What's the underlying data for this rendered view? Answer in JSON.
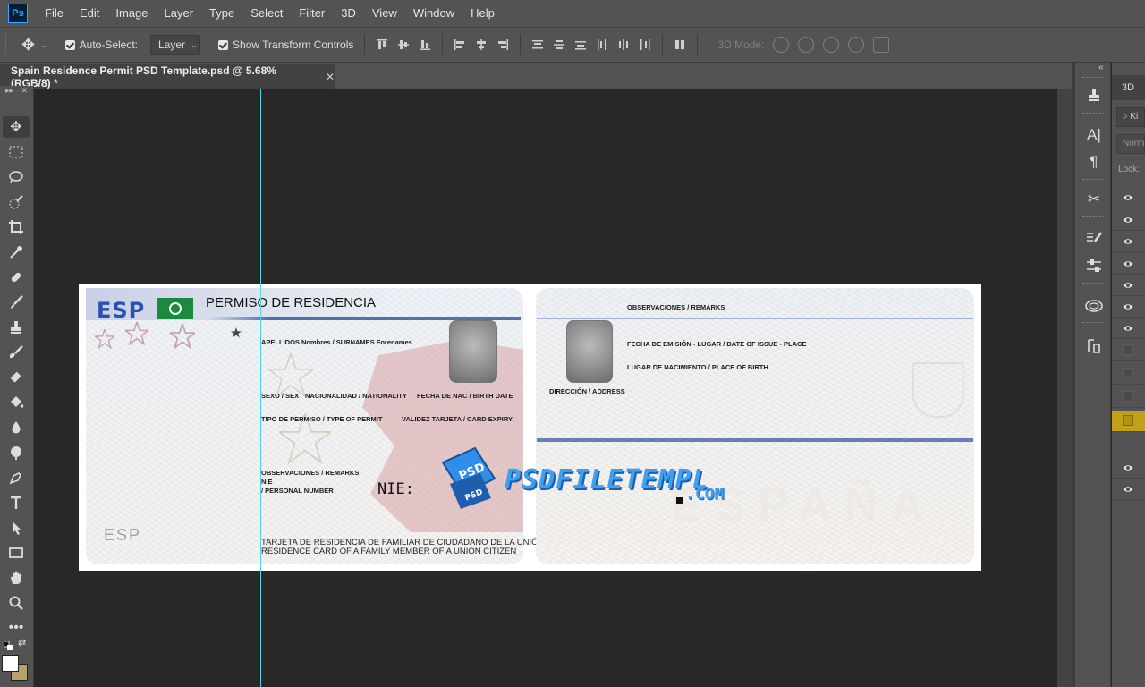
{
  "app": {
    "logo": "Ps"
  },
  "menu": [
    "File",
    "Edit",
    "Image",
    "Layer",
    "Type",
    "Select",
    "Filter",
    "3D",
    "View",
    "Window",
    "Help"
  ],
  "options": {
    "tool_icon": "move-icon",
    "auto_select_label": "Auto-Select:",
    "auto_select_checked": true,
    "target_value": "Layer",
    "transform_label": "Show Transform Controls",
    "transform_checked": true,
    "mode_3d_label": "3D Mode:"
  },
  "document": {
    "tab_title": "Spain Residence Permit PSD Template.psd @ 5.68% (RGB/8) *",
    "close_glyph": "✕"
  },
  "toolbox": {
    "head_left": "▸▸",
    "head_right": "✕",
    "tools": [
      "move-icon",
      "marquee-icon",
      "lasso-icon",
      "quick-select-icon",
      "crop-icon",
      "eyedropper-icon",
      "healing-brush-icon",
      "brush-icon",
      "clone-stamp-icon",
      "history-brush-icon",
      "eraser-icon",
      "paint-bucket-icon",
      "blur-icon",
      "dodge-icon",
      "pen-icon",
      "type-icon",
      "path-select-icon",
      "rectangle-icon",
      "hand-icon",
      "zoom-icon",
      "more-icon"
    ],
    "foreground_color": "#ffffff",
    "background_color": "#b6a36b"
  },
  "card_front": {
    "country_code": "ESP",
    "title": "PERMISO DE RESIDENCIA",
    "surnames_label": "APELLIDOS Nombres / SURNAMES Forenames",
    "sex_label": "SEXO / SEX",
    "nationality_label": "NACIONALIDAD / NATIONALITY",
    "birth_date_label": "FECHA DE NAC / BIRTH DATE",
    "permit_type_label": "TIPO DE PERMISO / TYPE OF PERMIT",
    "card_expiry_label": "VALIDEZ TARJETA / CARD EXPIRY",
    "remarks_label": "OBSERVACIONES / REMARKS",
    "nie_short": "NIE",
    "personal_number_label": "/ PERSONAL NUMBER",
    "nie_field": "NIE:",
    "watermark_code": "ESP",
    "footer_line1": "TARJETA DE RESIDENCIA DE FAMILIAR DE CIUDADANO DE LA UNIÓN",
    "footer_line2": "RESIDENCE CARD OF A FAMILY MEMBER OF A UNION CITIZEN"
  },
  "card_back": {
    "remarks_label": "OBSERVACIONES / REMARKS",
    "issue_label": "FECHA DE EMISIÓN - LUGAR / DATE OF ISSUE - PLACE",
    "birth_place_label": "LUGAR DE NACIMIENTO / PLACE OF BIRTH",
    "address_label": "DIRECCIÓN / ADDRESS",
    "watermark_country": "ESPAÑA"
  },
  "watermark": {
    "badge_text": "PSD",
    "site_name": "PSDFILETEMPL",
    "site_tld": ".COM"
  },
  "right_panel": {
    "collapse_glyph": "«",
    "tab_label": "3D",
    "search_placeholder": "Ki",
    "blend_mode": "Norm",
    "lock_label": "Lock:",
    "dock_icons": [
      "clone-source-icon",
      "character-icon",
      "paragraph-icon",
      "tools-icon",
      "brush-settings-icon",
      "adjustments-icon",
      "libraries-icon",
      "history-icon"
    ],
    "layers": [
      {
        "visible": true
      },
      {
        "visible": true
      },
      {
        "visible": true
      },
      {
        "visible": true
      },
      {
        "visible": true
      },
      {
        "visible": true
      },
      {
        "visible": true
      },
      {
        "visible": false
      },
      {
        "visible": false
      },
      {
        "visible": false
      },
      {
        "visible": false,
        "selected": true
      },
      {
        "visible": true
      },
      {
        "visible": true
      }
    ],
    "selected_color": "#c2a017"
  }
}
